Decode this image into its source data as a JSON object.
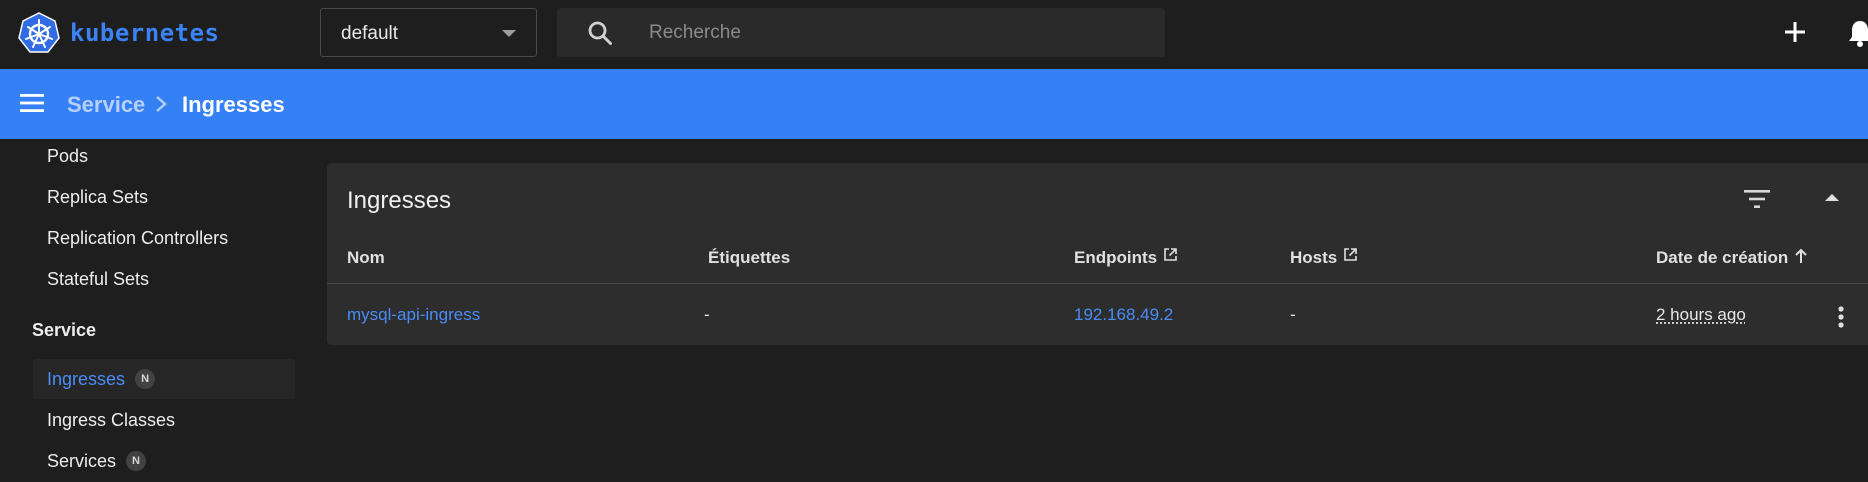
{
  "topbar": {
    "brand": "kubernetes",
    "namespace": "default",
    "search_placeholder": "Recherche",
    "icons": [
      "kubernetes-logo-icon",
      "search-icon",
      "plus-icon",
      "bell-icon"
    ]
  },
  "breadcrumb": {
    "parent": "Service",
    "current": "Ingresses"
  },
  "sidebar": {
    "items_top": [
      {
        "label": "Pods"
      },
      {
        "label": "Replica Sets"
      },
      {
        "label": "Replication Controllers"
      },
      {
        "label": "Stateful Sets"
      }
    ],
    "group": "Service",
    "items_service": [
      {
        "label": "Ingresses",
        "badge": "N"
      },
      {
        "label": "Ingress Classes"
      },
      {
        "label": "Services",
        "badge": "N"
      }
    ]
  },
  "card": {
    "title": "Ingresses",
    "columns": [
      "Nom",
      "Étiquettes",
      "Endpoints",
      "Hosts",
      "Date de création"
    ],
    "rows": [
      {
        "name": "mysql-api-ingress",
        "labels": "-",
        "endpoints": "192.168.49.2",
        "hosts": "-",
        "created": "2 hours ago"
      }
    ]
  },
  "colors": {
    "accent": "#3480f4",
    "link": "#4a8cf7",
    "background": "#1e1e1e",
    "card": "#2d2d2d"
  }
}
